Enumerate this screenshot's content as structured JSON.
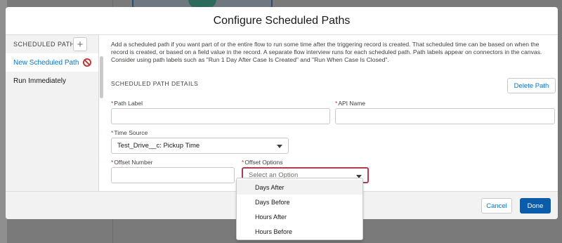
{
  "modal": {
    "title": "Configure Scheduled Paths"
  },
  "nav": {
    "header": "SCHEDULED PATHS",
    "add_icon": "plus-icon",
    "items": [
      {
        "label": "New Scheduled Path",
        "active": true,
        "error_icon": "error-circle-icon"
      },
      {
        "label": "Run Immediately",
        "active": false
      }
    ]
  },
  "content": {
    "description": "Add a scheduled path if you want part of or the entire flow to run some time after the triggering record is created. That scheduled time can be based on when the record is created, or based on a field value in the record. A separate flow interview runs for each scheduled path. Path labels appear on connectors in the canvas. Consider using path labels such as \"Run 1 Day After Case Is Created\" and \"Run When Case Is Closed\".",
    "section_title": "SCHEDULED PATH DETAILS",
    "delete_button": "Delete Path",
    "fields": {
      "path_label": {
        "label": "Path Label",
        "value": ""
      },
      "api_name": {
        "label": "API Name",
        "value": ""
      },
      "time_source": {
        "label": "Time Source",
        "value": "Test_Drive__c: Pickup Time"
      },
      "offset_number": {
        "label": "Offset Number",
        "value": ""
      },
      "offset_options": {
        "label": "Offset Options",
        "placeholder": "Select an Option"
      }
    },
    "required_marker": "*"
  },
  "dropdown": {
    "options": [
      "Days After",
      "Days Before",
      "Hours After",
      "Hours Before"
    ]
  },
  "footer": {
    "cancel": "Cancel",
    "done": "Done"
  },
  "colors": {
    "accent": "#0176d3",
    "brand_button": "#0b5cab",
    "error": "#c23934",
    "focus_border": "#b23a51"
  }
}
